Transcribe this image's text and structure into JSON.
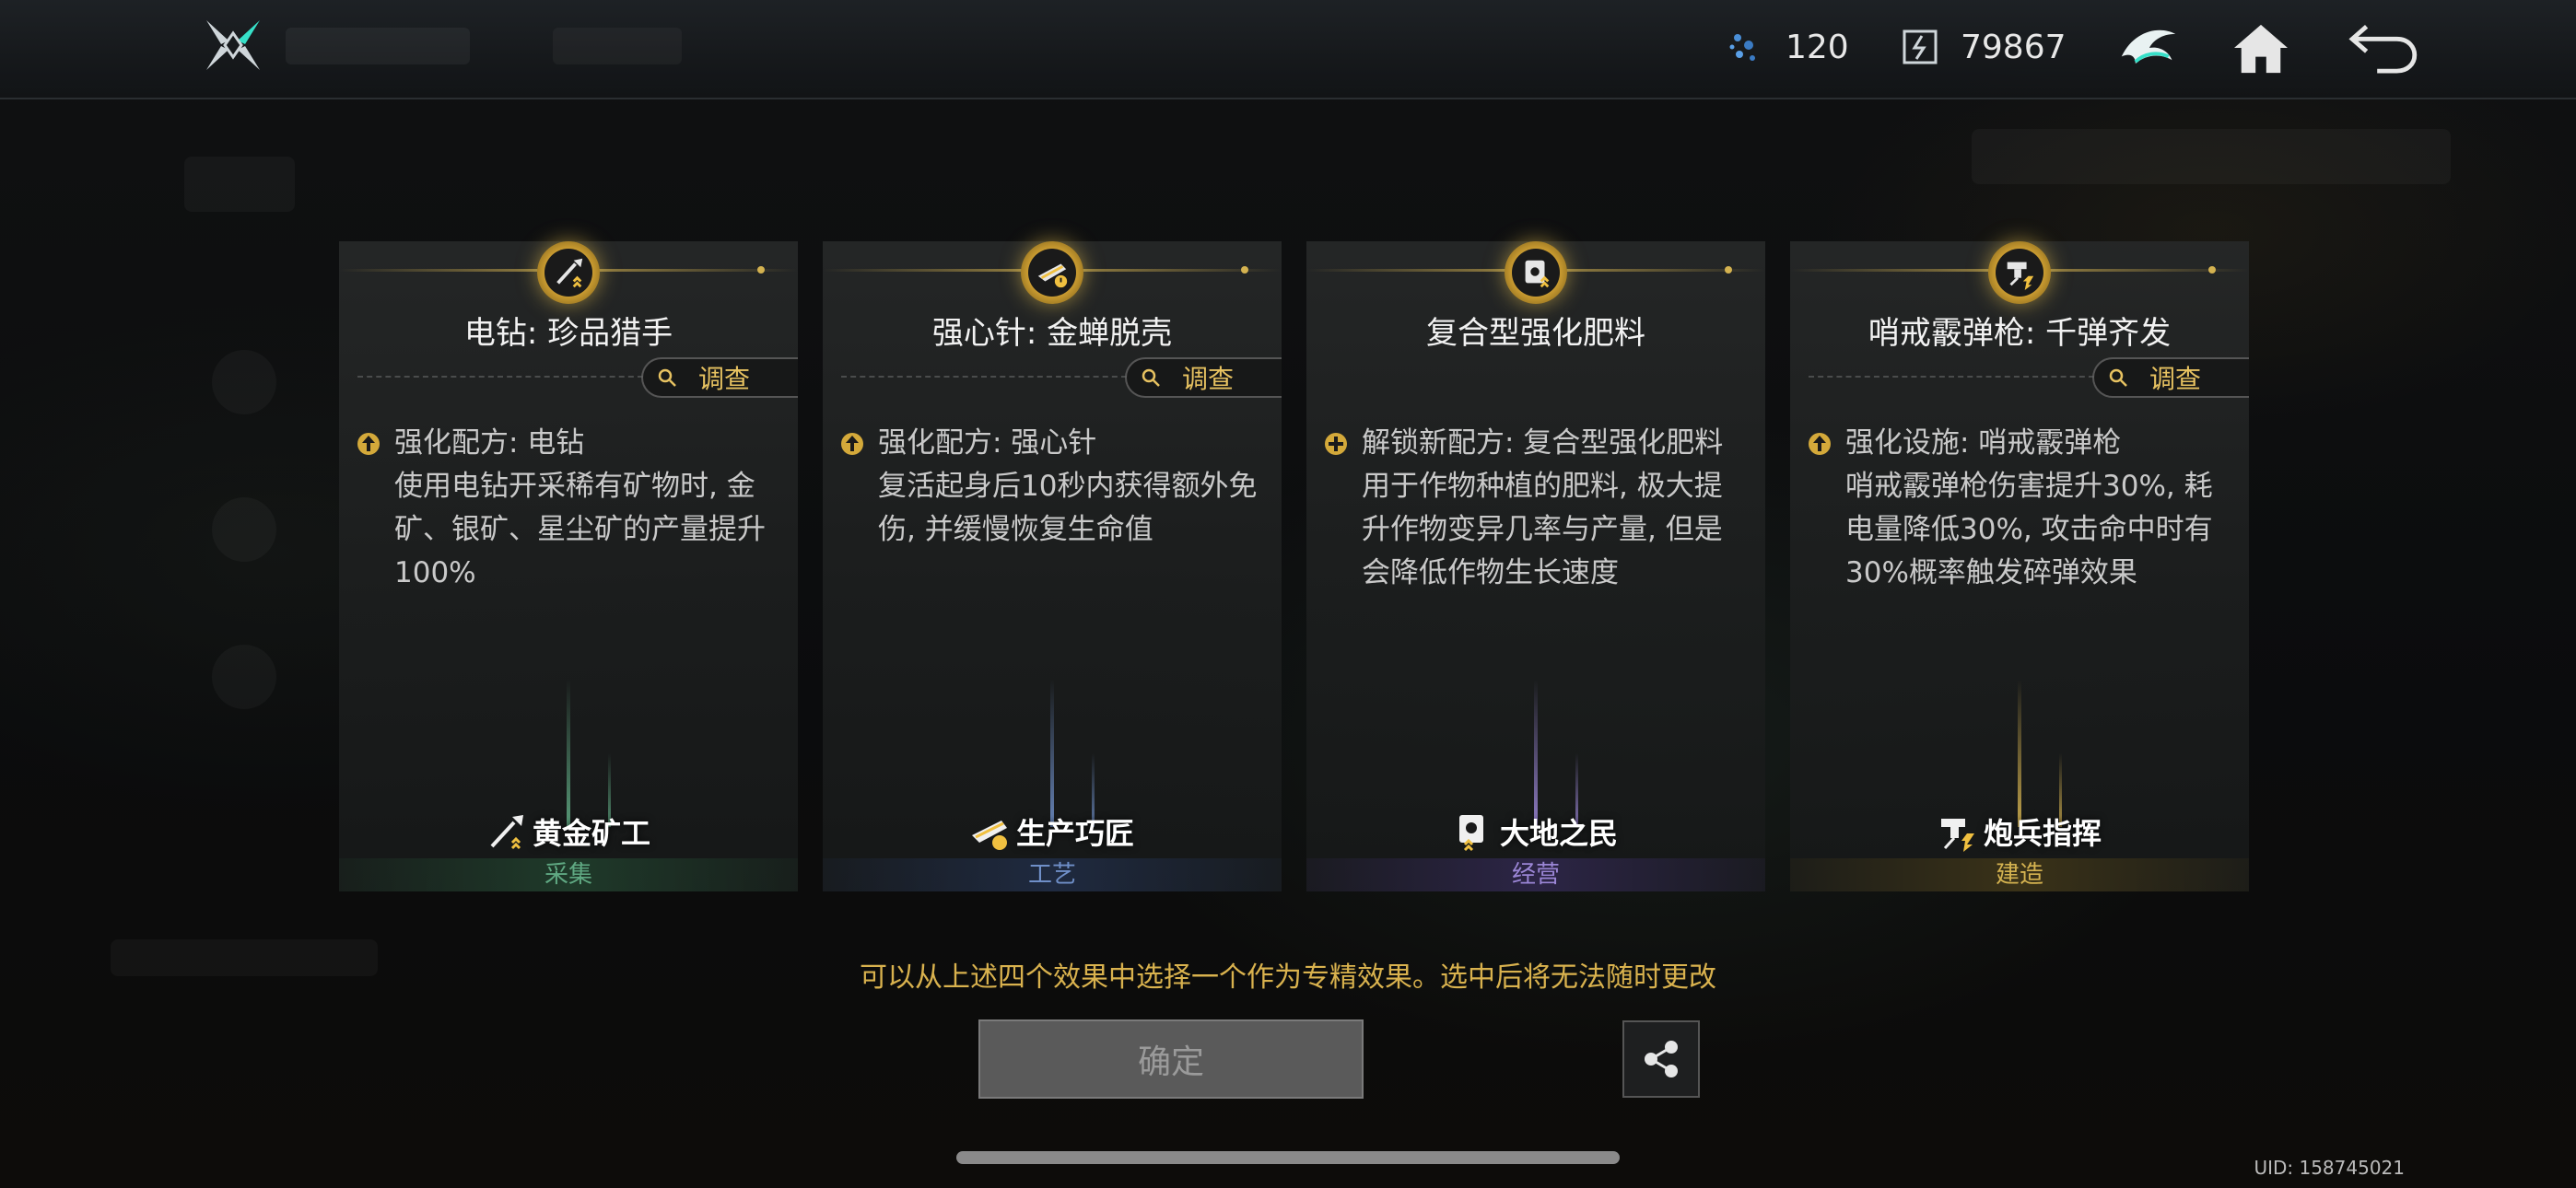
{
  "resources": [
    {
      "icon": "energy-crystal-icon",
      "value": "120"
    },
    {
      "icon": "currency-chip-icon",
      "value": "79867"
    }
  ],
  "cards": [
    {
      "icon": "drill-icon",
      "title": "电钻: 珍品猎手",
      "survey_label": "调查",
      "effect_icon": "upgrade-icon",
      "effect_title": "强化配方: 电钻",
      "effect_desc": "使用电钻开采稀有矿物时, 金矿、银矿、星尘矿的产量提升100%",
      "role": "黄金矿工",
      "category": "采集",
      "accent": "#5fa882",
      "category_bg": "#1f3a2a"
    },
    {
      "icon": "stimulant-injector-icon",
      "title": "强心针: 金蝉脱壳",
      "survey_label": "调查",
      "effect_icon": "upgrade-icon",
      "effect_title": "强化配方: 强心针",
      "effect_desc": "复活起身后10秒内获得额外免伤, 并缓慢恢复生命值",
      "role": "生产巧匠",
      "category": "工艺",
      "accent": "#6f8fc8",
      "category_bg": "#1f2a40"
    },
    {
      "icon": "fertilizer-bag-icon",
      "title": "复合型强化肥料",
      "survey_label": "",
      "effect_icon": "unlock-plus-icon",
      "effect_title": "解锁新配方: 复合型强化肥料",
      "effect_desc": "用于作物种植的肥料, 极大提升作物变异几率与产量, 但是会降低作物生长速度",
      "role": "大地之民",
      "category": "经营",
      "accent": "#9b86d6",
      "category_bg": "#2c2546"
    },
    {
      "icon": "shotgun-turret-icon",
      "title": "哨戒霰弹枪: 千弹齐发",
      "survey_label": "调查",
      "effect_icon": "upgrade-icon",
      "effect_title": "强化设施: 哨戒霰弹枪",
      "effect_desc": "哨戒霰弹枪伤害提升30%, 耗电量降低30%, 攻击命中时有30%概率触发碎弹效果",
      "role": "炮兵指挥",
      "category": "建造",
      "accent": "#d4b250",
      "category_bg": "#3a3218"
    }
  ],
  "hint": "可以从上述四个效果中选择一个作为专精效果。选中后将无法随时更改",
  "confirm_label": "确定",
  "uid": "UID: 158745021"
}
